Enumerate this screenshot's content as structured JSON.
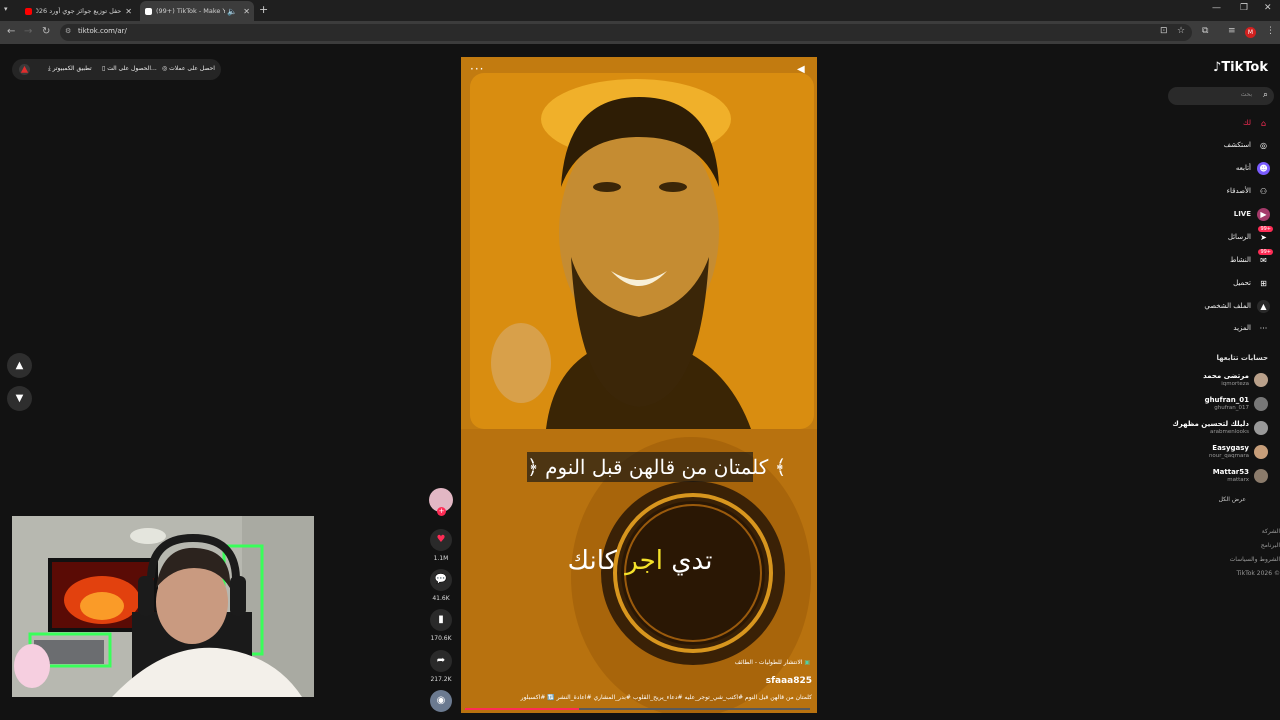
{
  "browser": {
    "tabs": [
      {
        "title": "حفل توزيع جوائز جوي أورد 2026",
        "favicon_color": "#ff0000"
      },
      {
        "title": "(99+) TikTok - Make Your Day",
        "favicon_color": "#ffffff"
      }
    ],
    "url": "tiktok.com/ar/",
    "profile_initial": "M"
  },
  "top_bar": {
    "desktop_app": "تطبيق الكمبيوتر",
    "get_app": "الحصول على الت...",
    "get_coins": "احصل على عملات"
  },
  "sidebar": {
    "logo": "TikTok",
    "search_placeholder": "بحث",
    "nav": [
      {
        "label": "لك",
        "icon": "home-icon",
        "active": true
      },
      {
        "label": "استكشف",
        "icon": "compass-icon"
      },
      {
        "label": "أتابعه",
        "icon": "following-icon"
      },
      {
        "label": "الأصدقاء",
        "icon": "friends-icon"
      },
      {
        "label": "LIVE",
        "icon": "live-icon"
      },
      {
        "label": "الرسائل",
        "icon": "messages-icon",
        "badge": "99+"
      },
      {
        "label": "النشاط",
        "icon": "activity-icon",
        "badge": "99+"
      },
      {
        "label": "تحميل",
        "icon": "upload-icon"
      },
      {
        "label": "الملف الشخصي",
        "icon": "profile-icon"
      },
      {
        "label": "المزيد",
        "icon": "more-icon"
      }
    ],
    "following_title": "حسابات تتابعها",
    "accounts": [
      {
        "name": "مرتضى محمد",
        "handle": "iqmorteza"
      },
      {
        "name": "ghufran_01",
        "handle": "ghufran_017"
      },
      {
        "name": "دليلك لتحسين مظهرك",
        "handle": "arabmenlooks"
      },
      {
        "name": "Easygasy",
        "handle": "nour_qaqmara"
      },
      {
        "name": "Mattar53",
        "handle": "mattarx"
      }
    ],
    "see_all": "عرض الكل",
    "footer": [
      "الشركة",
      "البرنامج",
      "الشروط والسياسات",
      "© 2026 TikTok"
    ]
  },
  "video": {
    "caption_line1": "﴿ كلمتان من قالهن قبل النوم ﴾",
    "caption_line2_part1": "تدي",
    "caption_line2_highlight": "اجر",
    "caption_line2_part2": "كانك",
    "location": "الانتشار للطوليات - الطائف",
    "author": "sfaaa825",
    "description": "كلمتان من قالهن قبل النوم #اكتب_شي_توجر_عليه #دعاء_يريح_القلوب #بدر_المشاري #اعادة_النشر 🔃 #اكسبلور",
    "progress": 0.33
  },
  "actions": {
    "likes": "1.1M",
    "comments": "41.6K",
    "saves": "170.6K",
    "shares": "217.2K"
  }
}
